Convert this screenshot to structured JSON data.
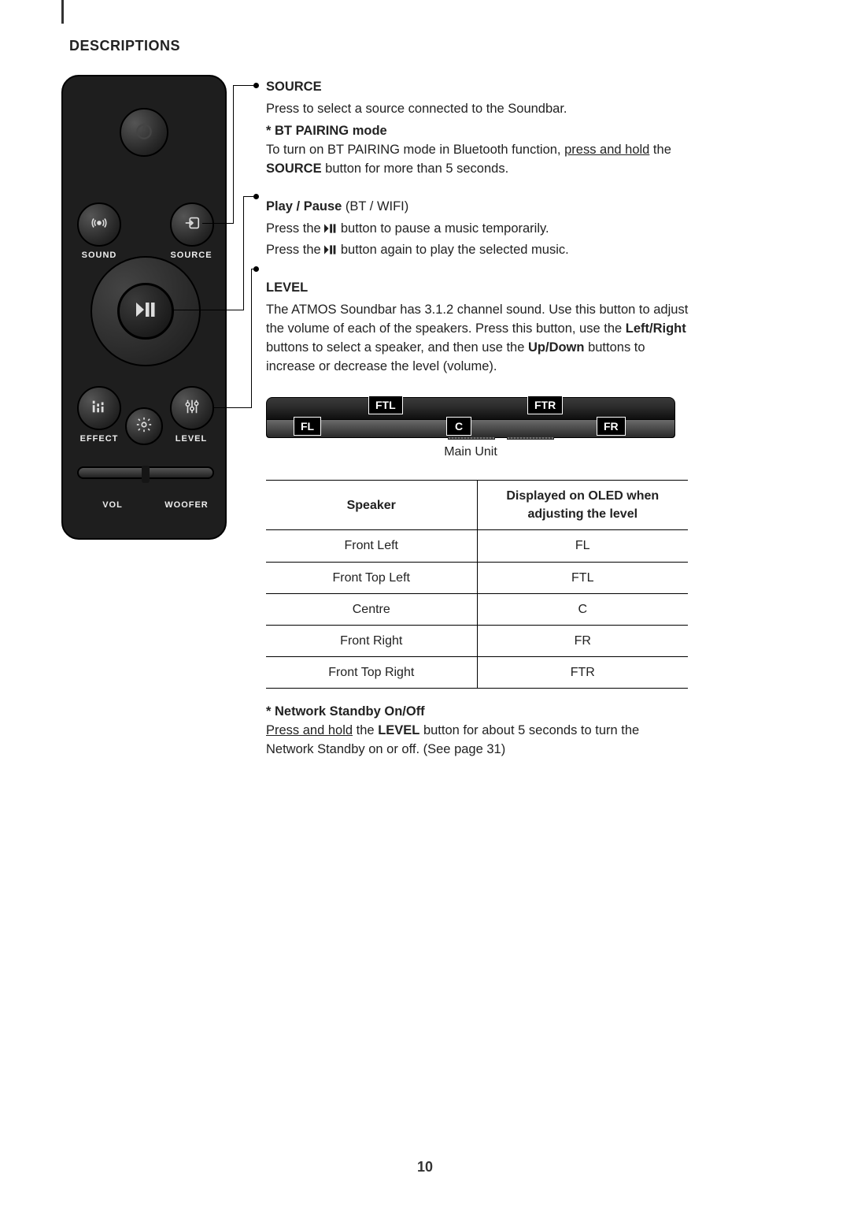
{
  "page": {
    "number": "10",
    "section_title": "DESCRIPTIONS"
  },
  "remote": {
    "labels": {
      "sound": "SOUND",
      "source": "SOURCE",
      "effect": "EFFECT",
      "level": "LEVEL",
      "vol": "VOL",
      "woofer": "WOOFER"
    },
    "icons": {
      "power": "power-icon",
      "sound": "broadcast-icon",
      "source": "input-icon",
      "play_pause": "play-pause-icon",
      "effect": "equalizer-icon",
      "gear": "gear-icon",
      "level": "sliders-icon"
    }
  },
  "source": {
    "heading": "SOURCE",
    "desc": "Press to select a source connected to the Soundbar.",
    "bt_title": "* BT PAIRING mode",
    "bt_line1_a": "To turn on BT PAIRING mode in Bluetooth function, ",
    "bt_line1_u": "press and hold",
    "bt_line1_b": " the ",
    "bt_line2_bold": "SOURCE",
    "bt_line2_rest": " button for more than 5 seconds."
  },
  "playpause": {
    "heading_bold": "Play / Pause ",
    "heading_rest": "(BT / WIFI)",
    "line1_a": "Press the ",
    "line1_b": " button to pause a music temporarily.",
    "line2_a": "Press the ",
    "line2_b": " button again to play the selected music."
  },
  "level": {
    "heading": "LEVEL",
    "p1_a": "The ATMOS Soundbar has 3.1.2 channel sound. Use this button to adjust the volume of each of the speakers. Press this button, use the ",
    "p1_b1": "Left/Right",
    "p1_c": " buttons to select a speaker, and then use the ",
    "p1_b2": "Up/Down",
    "p1_d": " buttons to increase or decrease the level (volume)."
  },
  "diagram": {
    "main_unit": "Main Unit",
    "tags": {
      "ftl": "FTL",
      "ftr": "FTR",
      "fl": "FL",
      "c": "C",
      "fr": "FR"
    }
  },
  "table": {
    "col1": "Speaker",
    "col2_l1": "Displayed on OLED when",
    "col2_l2": "adjusting the level",
    "rows": [
      {
        "speaker": "Front Left",
        "code": "FL"
      },
      {
        "speaker": "Front Top Left",
        "code": "FTL"
      },
      {
        "speaker": "Centre",
        "code": "C"
      },
      {
        "speaker": "Front Right",
        "code": "FR"
      },
      {
        "speaker": "Front Top Right",
        "code": "FTR"
      }
    ]
  },
  "network": {
    "title": "* Network Standby On/Off",
    "l1_u": "Press and hold",
    "l1_a": " the ",
    "l1_b": "LEVEL",
    "l1_c": " button for about 5 seconds to turn the Network Standby on or off. (See page 31)"
  }
}
